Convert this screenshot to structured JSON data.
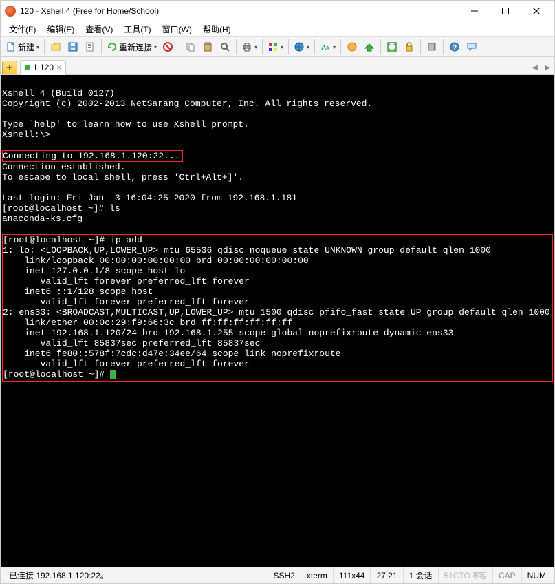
{
  "window": {
    "title": "120 - Xshell 4 (Free for Home/School)"
  },
  "menubar": [
    {
      "label": "文件(F)"
    },
    {
      "label": "编辑(E)"
    },
    {
      "label": "查看(V)"
    },
    {
      "label": "工具(T)"
    },
    {
      "label": "窗口(W)"
    },
    {
      "label": "帮助(H)"
    }
  ],
  "toolbar": {
    "new_label": "新建",
    "reconnect_label": "重新连接"
  },
  "tab": {
    "label": "1 120",
    "add_plus": "+"
  },
  "terminal": {
    "lines_top": [
      "Xshell 4 (Build 0127)",
      "Copyright (c) 2002-2013 NetSarang Computer, Inc. All rights reserved.",
      "",
      "Type `help' to learn how to use Xshell prompt.",
      "Xshell:\\>",
      ""
    ],
    "box1_line": "Connecting to 192.168.1.120:22...",
    "lines_mid": [
      "Connection established.",
      "To escape to local shell, press 'Ctrl+Alt+]'.",
      "",
      "Last login: Fri Jan  3 16:04:25 2020 from 192.168.1.181",
      "[root@localhost ~]# ls",
      "anaconda-ks.cfg"
    ],
    "box2_lines": [
      "[root@localhost ~]# ip add",
      "1: lo: <LOOPBACK,UP,LOWER_UP> mtu 65536 qdisc noqueue state UNKNOWN group default qlen 1000",
      "    link/loopback 00:00:00:00:00:00 brd 00:00:00:00:00:00",
      "    inet 127.0.0.1/8 scope host lo",
      "       valid_lft forever preferred_lft forever",
      "    inet6 ::1/128 scope host",
      "       valid_lft forever preferred_lft forever",
      "2: ens33: <BROADCAST,MULTICAST,UP,LOWER_UP> mtu 1500 qdisc pfifo_fast state UP group default qlen 1000",
      "    link/ether 00:0c:29:f9:66:3c brd ff:ff:ff:ff:ff:ff",
      "    inet 192.168.1.120/24 brd 192.168.1.255 scope global noprefixroute dynamic ens33",
      "       valid_lft 85837sec preferred_lft 85837sec",
      "    inet6 fe80::578f:7cdc:d47e:34ee/64 scope link noprefixroute",
      "       valid_lft forever preferred_lft forever"
    ],
    "box2_prompt": "[root@localhost ~]# "
  },
  "statusbar": {
    "connected": "已连接 192.168.1.120:22。",
    "protocol": "SSH2",
    "term": "xterm",
    "size": "111x44",
    "pos": "27,21",
    "sessions": "1 会话",
    "caps": "CAP",
    "num": "NUM",
    "watermark": "51CTO博客"
  }
}
